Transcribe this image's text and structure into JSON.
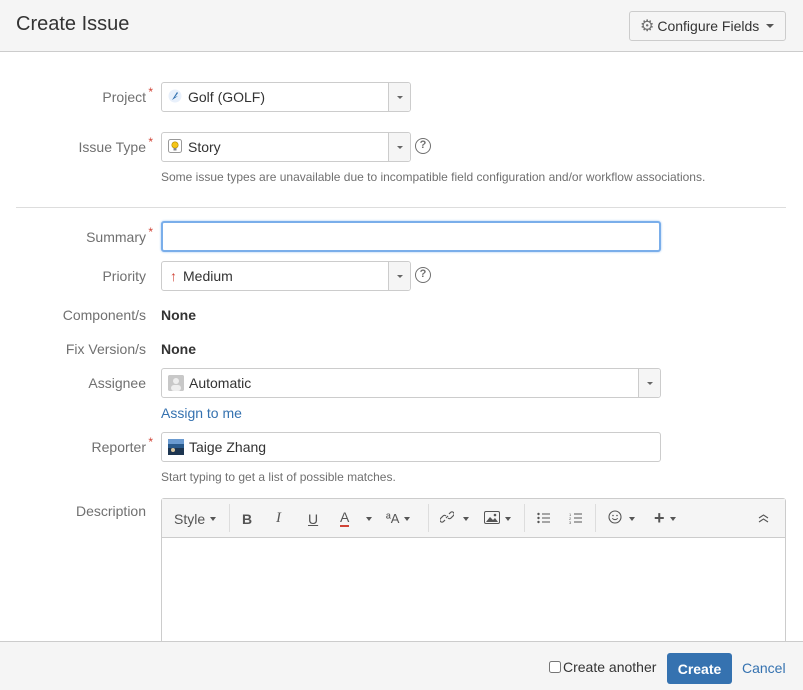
{
  "header": {
    "title": "Create Issue",
    "configure_fields": "Configure Fields"
  },
  "fields": {
    "project": {
      "label": "Project",
      "required": "*",
      "value": "Golf (GOLF)",
      "icon": "project-icon"
    },
    "issue_type": {
      "label": "Issue Type",
      "required": "*",
      "value": "Story",
      "icon": "story-lightbulb-icon",
      "hint": "Some issue types are unavailable due to incompatible field configuration and/or workflow associations."
    },
    "summary": {
      "label": "Summary",
      "required": "*",
      "value": "",
      "placeholder": ""
    },
    "priority": {
      "label": "Priority",
      "value": "Medium",
      "icon": "arrow-up-icon",
      "icon_color": "#d04437"
    },
    "components": {
      "label": "Component/s",
      "value": "None"
    },
    "fix_versions": {
      "label": "Fix Version/s",
      "value": "None"
    },
    "assignee": {
      "label": "Assignee",
      "value": "Automatic",
      "assign_to_me": "Assign to me"
    },
    "reporter": {
      "label": "Reporter",
      "required": "*",
      "value": "Taige Zhang",
      "hint": "Start typing to get a list of possible matches."
    },
    "description": {
      "label": "Description",
      "toolbar": {
        "style": "Style",
        "bold": "B",
        "italic": "I",
        "underline": "U",
        "text_color": "A",
        "more_formatting": "ªA"
      }
    }
  },
  "footer": {
    "create_another": "Create another",
    "create_another_checked": false,
    "create": "Create",
    "cancel": "Cancel"
  },
  "colors": {
    "primary": "#3572b0",
    "required": "#d04437",
    "focus_border": "#7aaeea",
    "text_color_underline": "#d04437"
  }
}
